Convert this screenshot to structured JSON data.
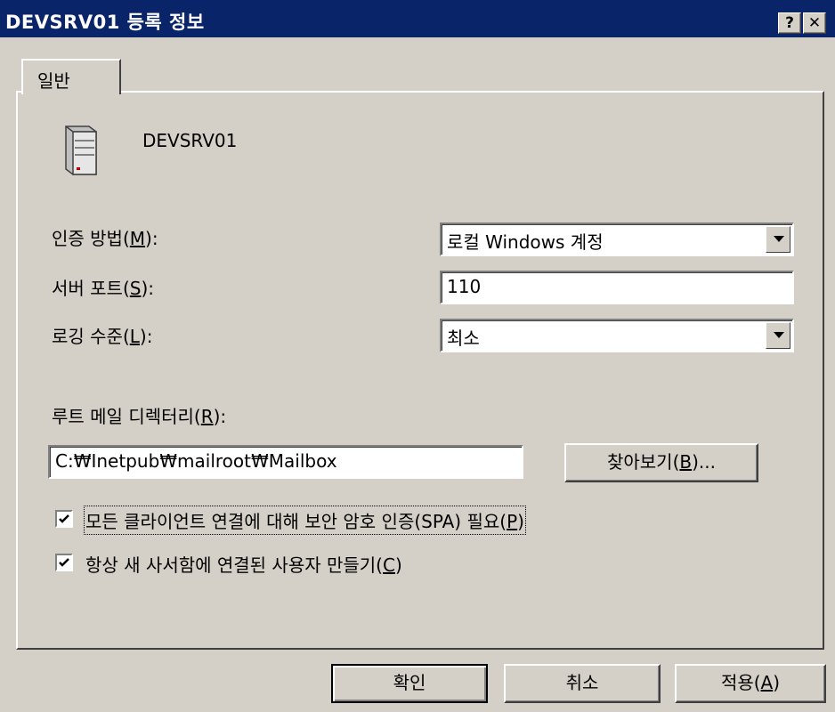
{
  "window": {
    "title": "DEVSRV01 등록 정보",
    "help_label": "?",
    "close_label": "✕"
  },
  "tab": {
    "label": "일반"
  },
  "server": {
    "name": "DEVSRV01",
    "icon": "server-icon"
  },
  "auth": {
    "label_prefix": "인증 방법(",
    "mnemonic": "M",
    "label_suffix": "):",
    "value": "로컬 Windows 계정"
  },
  "port": {
    "label_prefix": "서버 포트(",
    "mnemonic": "S",
    "label_suffix": "):",
    "value": "110"
  },
  "logging": {
    "label_prefix": "로깅 수준(",
    "mnemonic": "L",
    "label_suffix": "):",
    "value": "최소"
  },
  "root": {
    "label_prefix": "루트 메일 디렉터리(",
    "mnemonic": "R",
    "label_suffix": "):",
    "value": "C:₩Inetpub₩mailroot₩Mailbox"
  },
  "browse": {
    "prefix": "찾아보기(",
    "mnemonic": "B",
    "suffix": ")..."
  },
  "spa": {
    "checked": true,
    "prefix": "모든 클라이언트 연결에 대해 보안 암호 인증(SPA) 필요(",
    "mnemonic": "P",
    "suffix": ")"
  },
  "mailbox": {
    "checked": true,
    "prefix": "항상 새 사서함에 연결된 사용자 만들기(",
    "mnemonic": "C",
    "suffix": ")"
  },
  "buttons": {
    "ok": "확인",
    "cancel": "취소",
    "apply_prefix": "적용(",
    "apply_mnemonic": "A",
    "apply_suffix": ")"
  },
  "colors": {
    "titlebar": "#0a246a",
    "face": "#d4d0c8"
  }
}
